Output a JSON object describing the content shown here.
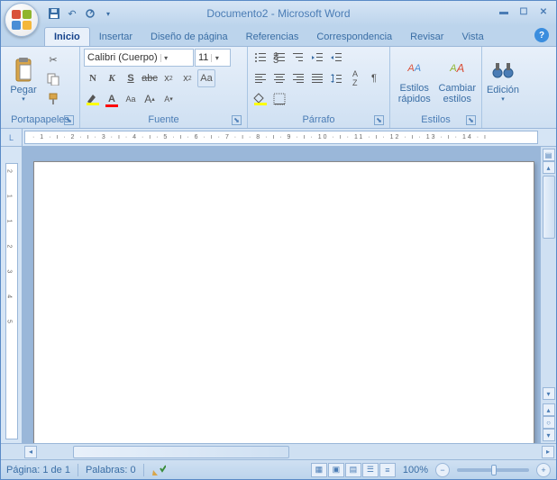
{
  "title": "Documento2 - Microsoft Word",
  "tabs": [
    "Inicio",
    "Insertar",
    "Diseño de página",
    "Referencias",
    "Correspondencia",
    "Revisar",
    "Vista"
  ],
  "activeTab": 0,
  "ribbon": {
    "clipboard": {
      "label": "Portapapeles",
      "paste": "Pegar"
    },
    "font": {
      "label": "Fuente",
      "family": "Calibri (Cuerpo)",
      "size": "11"
    },
    "paragraph": {
      "label": "Párrafo"
    },
    "styles": {
      "label": "Estilos",
      "quick": "Estilos\nrápidos",
      "change": "Cambiar\nestilos"
    },
    "editing": {
      "label": "Edición"
    }
  },
  "ruler": "· 1 · ı · 2 · ı · 3 · ı · 4 · ı · 5 · ı · 6 · ı · 7 · ı · 8 · ı · 9 · ı · 10 · ı · 11 · ı · 12 · ı · 13 · ı · 14 · ı",
  "vruler": "2 1 1 2 3 4 5",
  "status": {
    "page": "Página: 1 de 1",
    "words": "Palabras: 0",
    "zoom": "100%"
  }
}
